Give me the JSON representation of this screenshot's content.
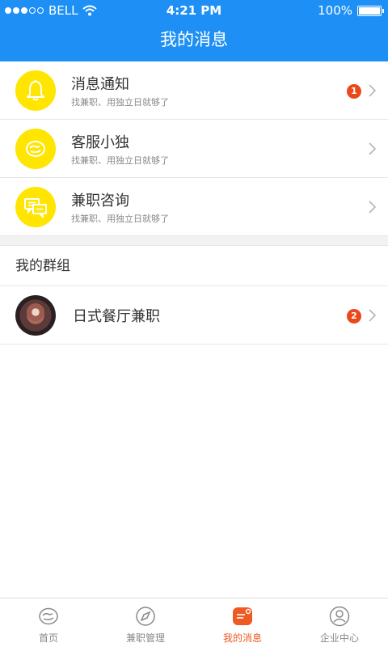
{
  "status_bar": {
    "carrier": "BELL",
    "time": "4:21 PM",
    "battery": "100%"
  },
  "header": {
    "title": "我的消息"
  },
  "messages": [
    {
      "title": "消息通知",
      "subtitle": "找兼职、用独立日就够了",
      "badge": "1",
      "icon": "bell-icon"
    },
    {
      "title": "客服小独",
      "subtitle": "找兼职、用独立日就够了",
      "badge": "",
      "icon": "service-icon"
    },
    {
      "title": "兼职咨询",
      "subtitle": "找兼职、用独立日就够了",
      "badge": "",
      "icon": "chat-bubbles-icon"
    }
  ],
  "groups": {
    "section_title": "我的群组",
    "items": [
      {
        "title": "日式餐厅兼职",
        "badge": "2"
      }
    ]
  },
  "tabbar": {
    "items": [
      {
        "label": "首页",
        "icon": "home-icon"
      },
      {
        "label": "兼职管理",
        "icon": "compass-icon"
      },
      {
        "label": "我的消息",
        "icon": "message-icon",
        "active": true
      },
      {
        "label": "企业中心",
        "icon": "user-icon"
      }
    ]
  },
  "colors": {
    "primary": "#1e90f5",
    "accent": "#ee5a22",
    "avatar_bg": "#ffe500",
    "badge": "#ea4a1b"
  }
}
